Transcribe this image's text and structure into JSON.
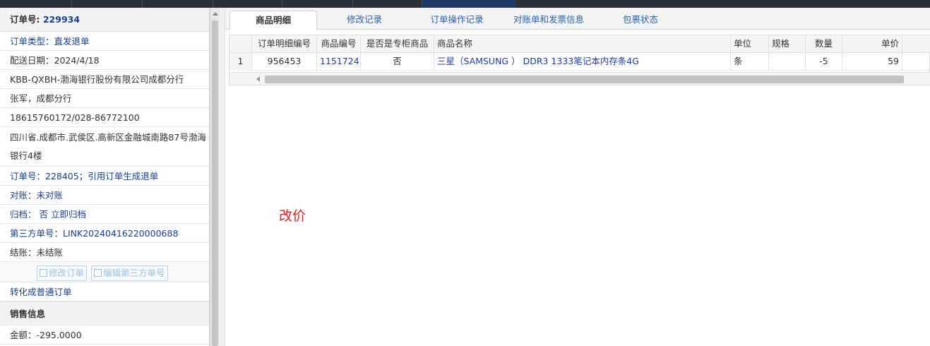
{
  "left_panel": {
    "order_no_label": "订单号:",
    "order_no_value": "229934",
    "rows": [
      {
        "key": "order_type",
        "text": "订单类型：直发退单",
        "style": "blue"
      },
      {
        "key": "delivery_date",
        "text": "配送日期：2024/4/18",
        "style": "gray"
      },
      {
        "key": "company",
        "text": "KBB-QXBH-渤海银行股份有限公司成都分行",
        "style": "gray"
      },
      {
        "key": "contact",
        "text": "张军，成都分行",
        "style": "gray"
      },
      {
        "key": "phone",
        "text": "18615760172/028-86772100",
        "style": "gray"
      }
    ],
    "address": "四川省.成都市.武侯区.高新区金融城南路87号渤海银行4楼",
    "rows2": [
      {
        "key": "source_order",
        "text": "订单号：228405；引用订单生成退单",
        "style": "blue"
      },
      {
        "key": "reconcile",
        "text": "对账：未对账",
        "style": "blue"
      },
      {
        "key": "archive",
        "text": "归档：  否 立即归档",
        "style": "blue"
      },
      {
        "key": "third_party",
        "text": "第三方单号：LINK20240416220000688",
        "style": "blue"
      },
      {
        "key": "settle",
        "text": "结账：未结账",
        "style": "gray"
      }
    ],
    "buttons": {
      "edit_order": "修改订单",
      "edit_third_party": "编辑第三方单号"
    },
    "convert_link": "转化成普通订单",
    "sales_section": "销售信息",
    "amount": "金额：-295.0000"
  },
  "tabs": [
    {
      "key": "details",
      "label": "商品明细",
      "active": true
    },
    {
      "key": "changes",
      "label": "修改记录",
      "active": false
    },
    {
      "key": "ops",
      "label": "订单操作记录",
      "active": false
    },
    {
      "key": "invoice",
      "label": "对账单和发票信息",
      "active": false
    },
    {
      "key": "package",
      "label": "包裹状态",
      "active": false
    }
  ],
  "grid": {
    "headers": {
      "detail_no": "订单明细编号",
      "product_no": "商品编号",
      "exclusive": "是否是专柜商品",
      "name": "商品名称",
      "unit": "单位",
      "spec": "规格",
      "qty": "数量",
      "price": "单价"
    },
    "rows": [
      {
        "index": "1",
        "detail_no": "956453",
        "product_no": "1151724",
        "exclusive": "否",
        "name": "三星（SAMSUNG ） DDR3 1333笔记本内存条4G",
        "unit": "条",
        "spec": "",
        "qty": "-5",
        "price": "59"
      }
    ]
  },
  "note": "改价"
}
